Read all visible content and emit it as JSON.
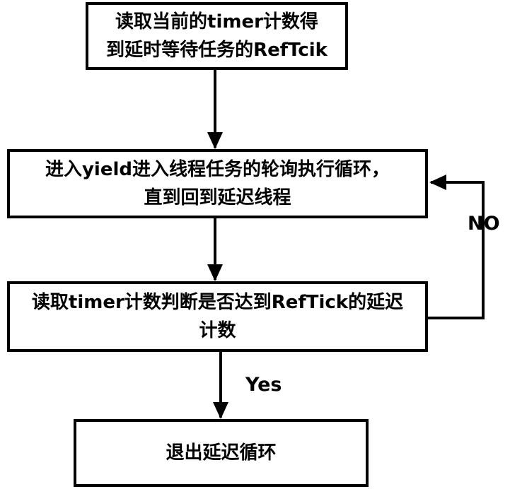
{
  "nodes": {
    "read_timer_reftick": "读取当前的timer计数得\n到延时等待任务的RefTcik",
    "yield_loop": "进入yield进入线程任务的轮询执行循环，\n直到回到延迟线程",
    "check_reftick": "读取timer计数判断是否达到RefTick的延迟\n计数",
    "exit_loop": "退出延迟循环"
  },
  "edges": {
    "no_label": "NO",
    "yes_label": "Yes"
  },
  "colors": {
    "stroke": "#000000",
    "background": "#ffffff"
  }
}
